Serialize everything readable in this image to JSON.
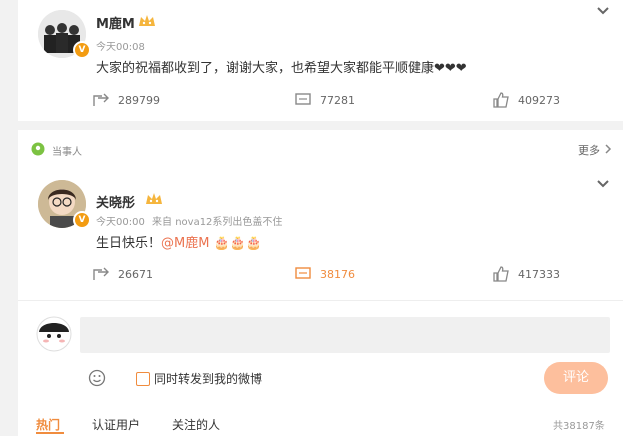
{
  "post1": {
    "username": "M鹿M",
    "time": "今天00:08",
    "text": "大家的祝福都收到了，谢谢大家，也希望大家都能平顺健康❤❤❤",
    "reposts": "289799",
    "comments": "77281",
    "likes": "409273"
  },
  "post2": {
    "tag": "当事人",
    "more": "更多",
    "username": "关晓彤",
    "time": "今天00:00",
    "source": "来自 nova12系列出色盖不住",
    "text_prefix": "生日快乐！",
    "mention": "@M鹿M",
    "emojis": "🎂🎂🎂",
    "reposts": "26671",
    "comments": "38176",
    "likes": "417333"
  },
  "comment_box": {
    "placeholder": "",
    "forward_label": "同时转发到我的微博",
    "submit_label": "评论"
  },
  "tabs": [
    "热门",
    "认证用户",
    "关注的人"
  ],
  "comment_count": "共38187条",
  "colors": {
    "accent": "#f08c3e",
    "badge": "#f39c12",
    "submit": "#fdbf9d"
  }
}
